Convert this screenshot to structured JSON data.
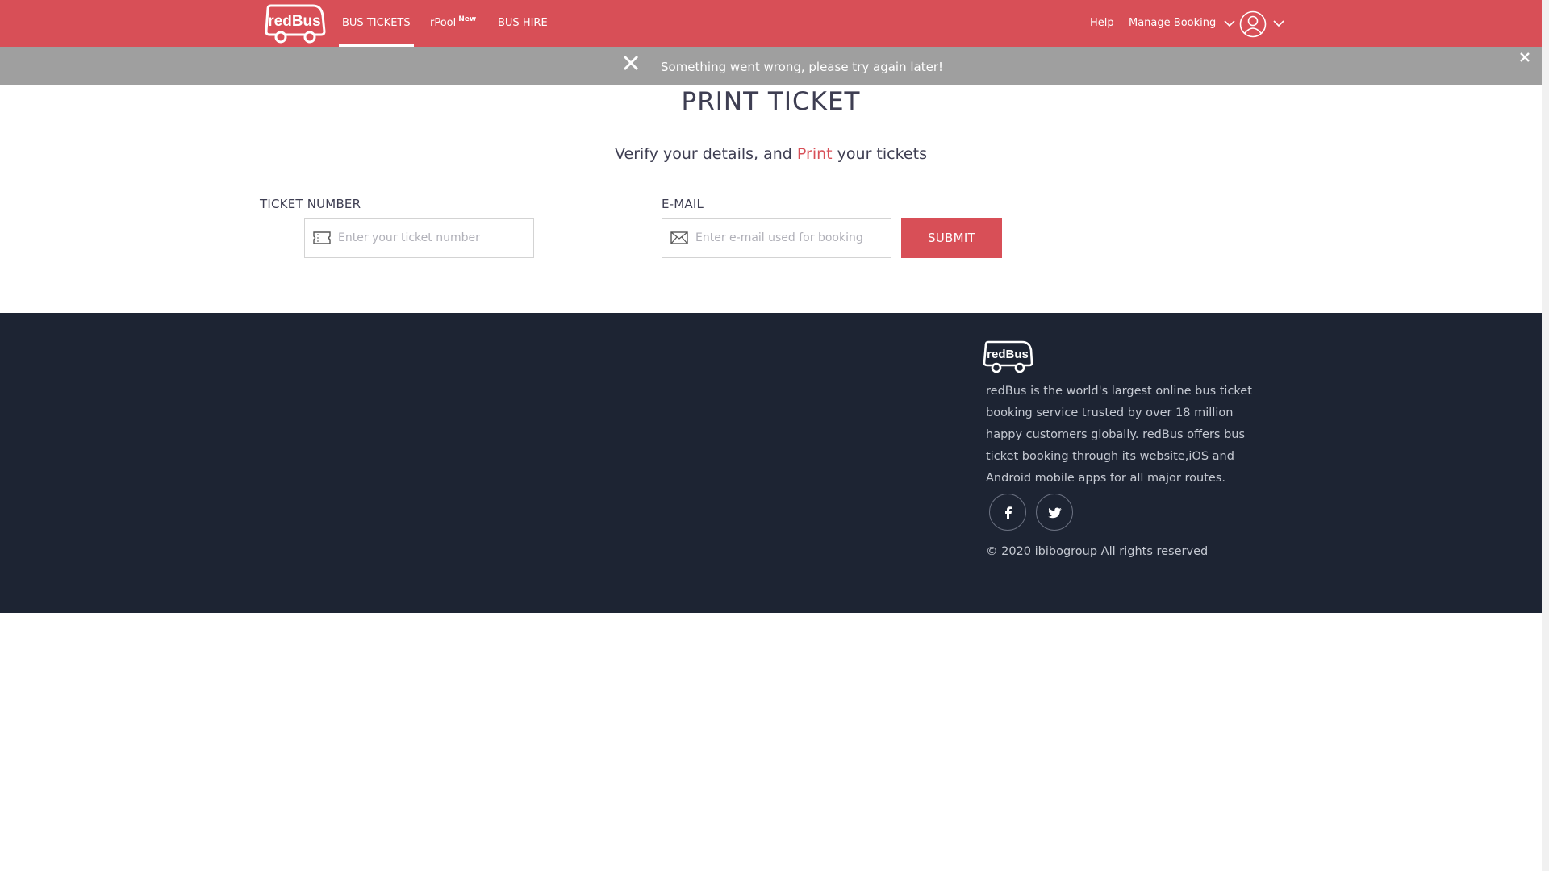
{
  "header": {
    "logo_text": "redBus",
    "nav": [
      {
        "label": "BUS TICKETS",
        "active": true
      },
      {
        "label": "rPool",
        "badge": "New",
        "active": false
      },
      {
        "label": "BUS HIRE",
        "active": false
      }
    ],
    "help_label": "Help",
    "manage_booking_label": "Manage Booking",
    "profile_icon": "user-circle-icon"
  },
  "banner": {
    "message": "Something went wrong, please try again later!",
    "close_icon": "close-icon"
  },
  "main": {
    "title": "PRINT TICKET",
    "subtitle_before": "Verify your details, and ",
    "subtitle_accent": "Print",
    "subtitle_after": " your tickets",
    "ticket_number": {
      "label": "TICKET NUMBER",
      "placeholder": "Enter your ticket number",
      "value": "",
      "icon": "ticket-icon"
    },
    "email": {
      "label": "E-MAIL",
      "placeholder": "Enter e-mail used for booking",
      "value": "",
      "icon": "envelope-icon"
    },
    "submit_label": "SUBMIT"
  },
  "footer": {
    "logo_text": "redBus",
    "about": "redBus is the world's largest online bus ticket booking service trusted by over 18 million happy customers globally. redBus offers bus ticket booking through its website,iOS and Android mobile apps for all major routes.",
    "social": [
      "facebook-icon",
      "twitter-icon"
    ],
    "copyright": "© 2020 ibibogroup All rights reserved"
  },
  "colors": {
    "brand": "#d84f57",
    "banner": "#9f9f9f",
    "footer": "#1d2433"
  }
}
